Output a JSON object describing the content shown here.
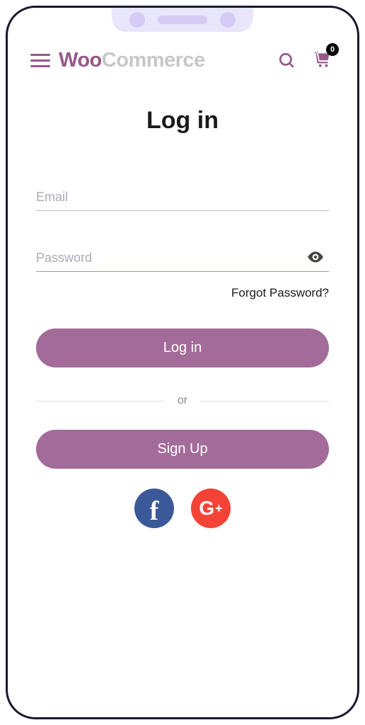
{
  "header": {
    "logo_part1": "Woo",
    "logo_part2": "Commerce",
    "cart_count": "0"
  },
  "login": {
    "title": "Log in",
    "email_placeholder": "Email",
    "password_placeholder": "Password",
    "forgot": "Forgot Password?",
    "login_button": "Log in",
    "divider": "or",
    "signup_button": "Sign Up"
  },
  "social": {
    "facebook": "f",
    "google_g": "G",
    "google_plus": "+"
  }
}
